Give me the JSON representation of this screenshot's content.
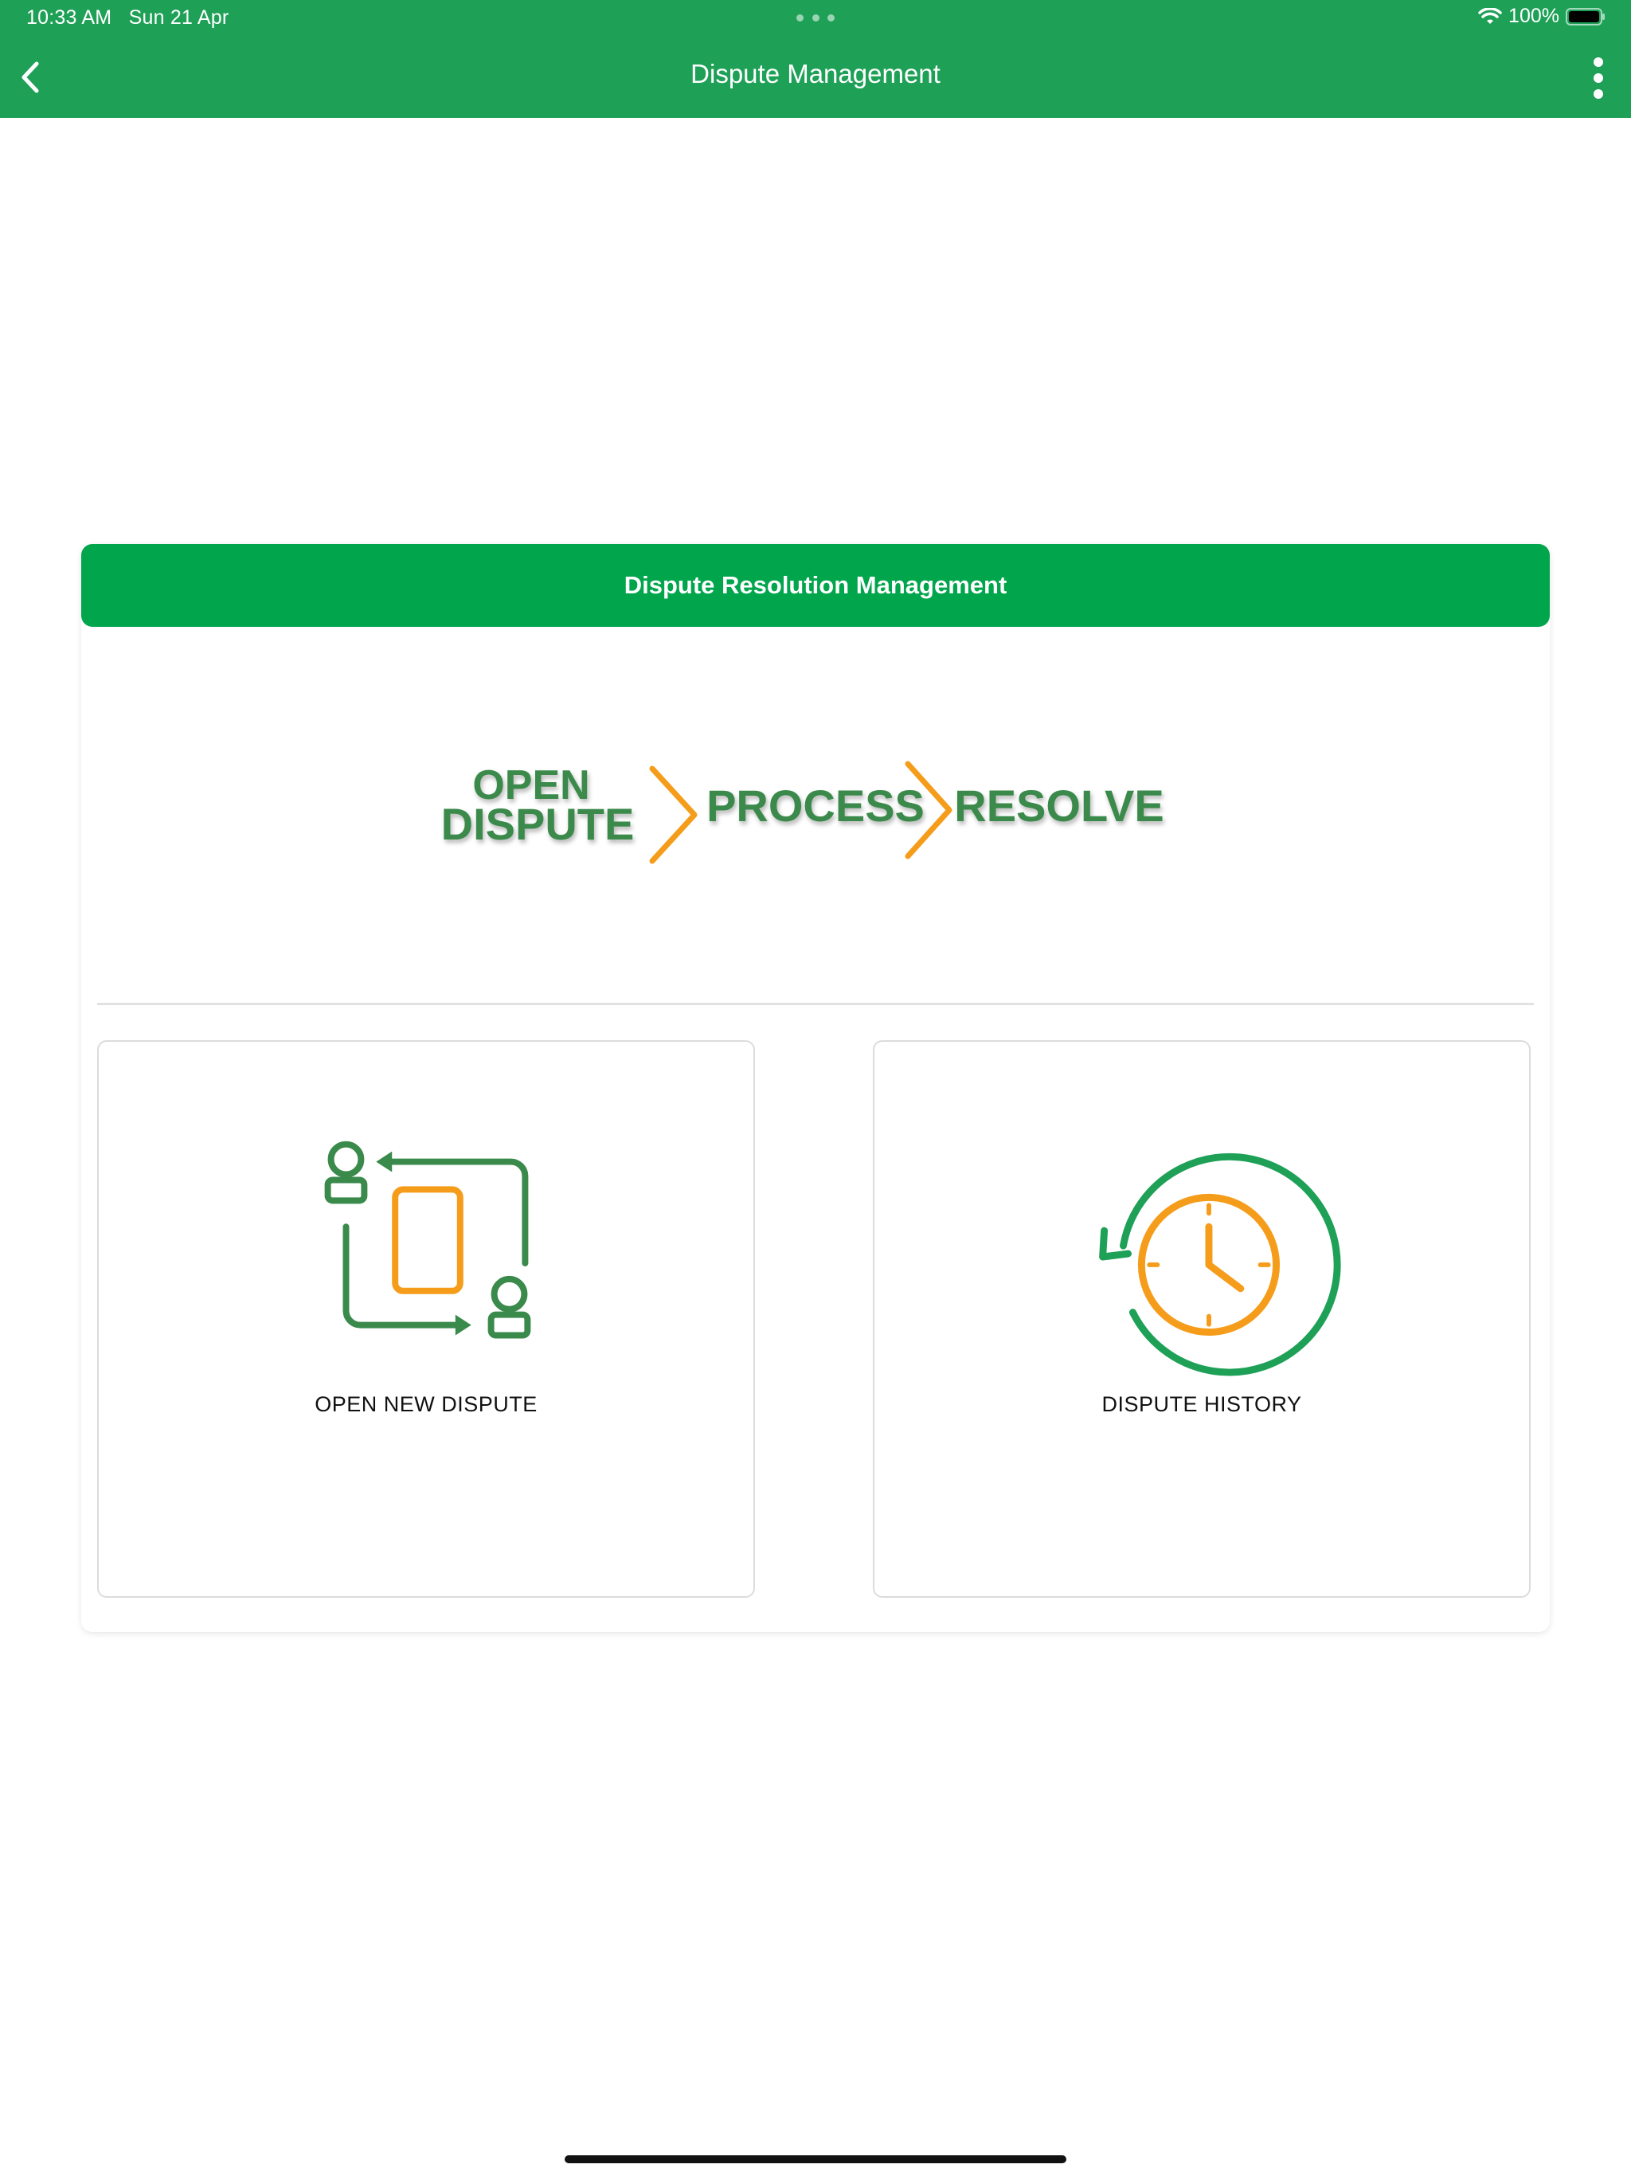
{
  "status_bar": {
    "time": "10:33 AM",
    "date": "Sun 21 Apr",
    "battery": "100%"
  },
  "nav": {
    "title": "Dispute Management",
    "back_icon": "chevron-left-icon",
    "menu_icon": "more-vertical-icon"
  },
  "card": {
    "header": "Dispute Resolution Management",
    "banner": {
      "step1_line1": "OPEN",
      "step1_line2": "DISPUTE",
      "step2": "PROCESS",
      "step3": "RESOLVE"
    },
    "tiles": [
      {
        "label": "OPEN NEW DISPUTE",
        "icon": "exchange-users-icon"
      },
      {
        "label": "DISPUTE HISTORY",
        "icon": "history-clock-icon"
      }
    ]
  },
  "colors": {
    "primary_green": "#1ea057",
    "header_green": "#00a54c",
    "banner_green": "#3a8a4c",
    "accent_orange": "#f59d1b"
  }
}
